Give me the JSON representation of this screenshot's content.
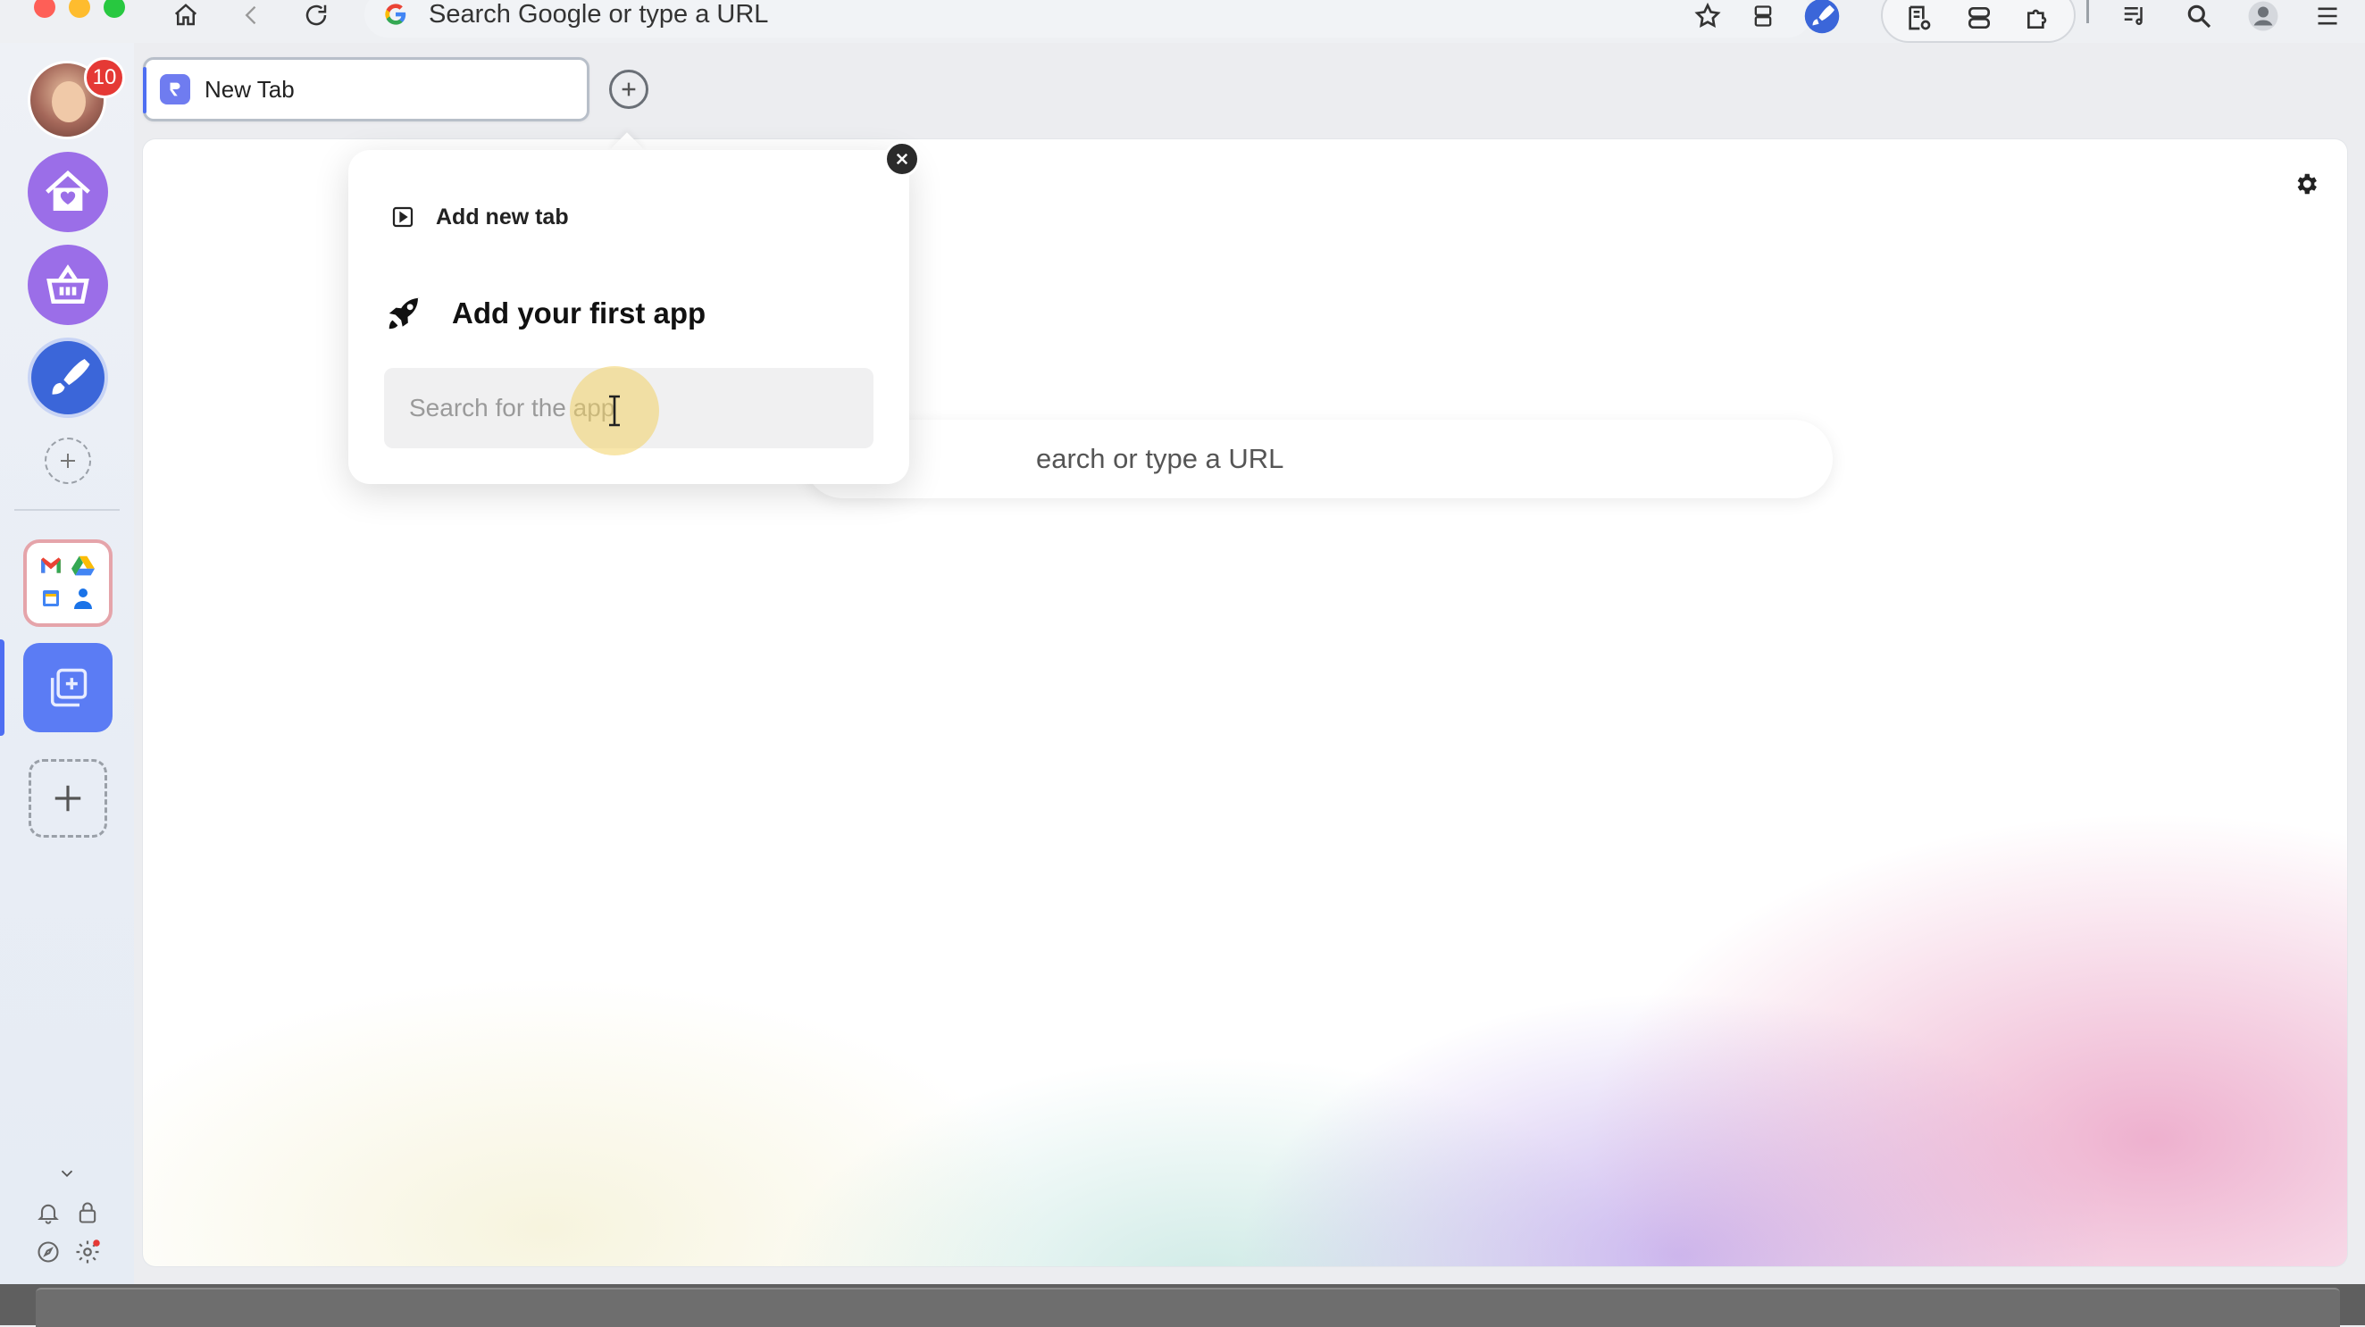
{
  "browser": {
    "omnibox_text": "Search Google or type a URL"
  },
  "sidebar": {
    "notification_count": "10",
    "spaces": [
      {
        "name": "home-space",
        "icon": "house-heart-icon"
      },
      {
        "name": "shopping-space",
        "icon": "basket-icon"
      },
      {
        "name": "paint-space",
        "icon": "brush-icon"
      }
    ],
    "apps_group": [
      "gmail",
      "google-drive",
      "google-calendar",
      "google-contacts"
    ]
  },
  "tab": {
    "title": "New Tab"
  },
  "main": {
    "search_text": "earch or type a URL"
  },
  "popup": {
    "add_new_tab_label": "Add new tab",
    "heading": "Add your first app",
    "search_placeholder": "Search for the app"
  },
  "colors": {
    "accent": "#4e6ef2",
    "space_purple": "#9b6ee8",
    "space_blue": "#3b66d9",
    "badge_red": "#e53935",
    "app_group_border": "#e5a4aa"
  }
}
